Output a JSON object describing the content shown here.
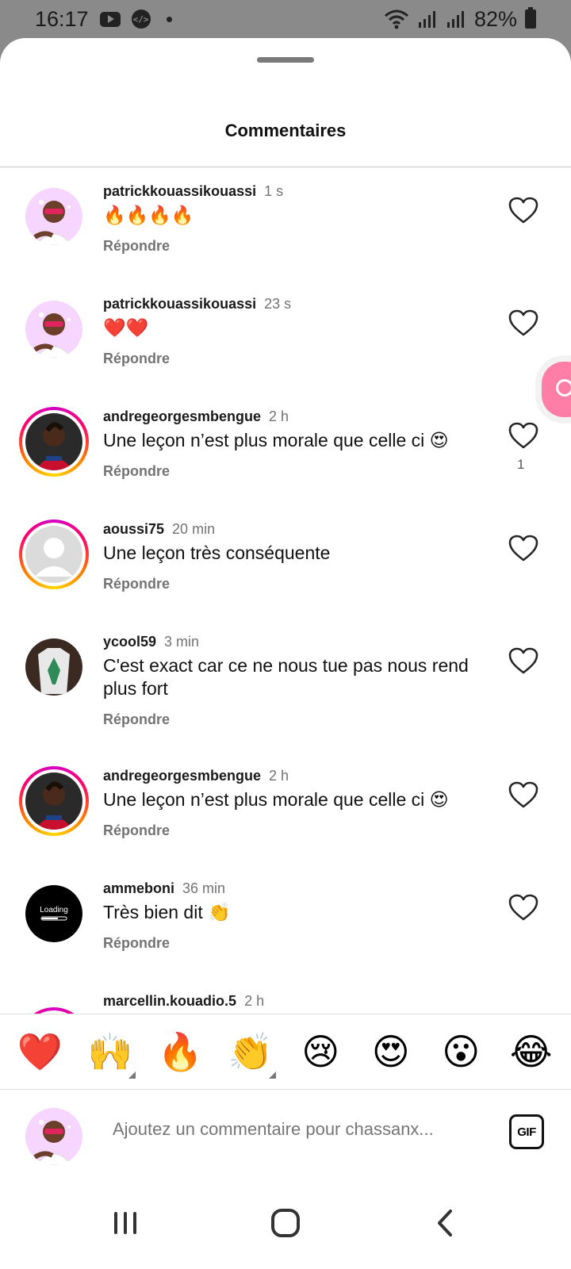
{
  "status_bar": {
    "time": "16:17",
    "battery": "82%",
    "icons": [
      "youtube-icon",
      "code-icon",
      "dot-icon",
      "wifi-icon",
      "signal-icon",
      "signal-icon",
      "battery-icon"
    ]
  },
  "sheet": {
    "title": "Commentaires"
  },
  "comments": [
    {
      "username": "patrickkouassikouassi",
      "time": "1 s",
      "text": "🔥🔥🔥🔥",
      "reply_label": "Répondre",
      "like_count": "",
      "avatar": "cartoon"
    },
    {
      "username": "patrickkouassikouassi",
      "time": "23 s",
      "text": "❤️❤️",
      "reply_label": "Répondre",
      "like_count": "",
      "avatar": "cartoon"
    },
    {
      "username": "andregeorgesmbengue",
      "time": "2 h",
      "text": "Une leçon n’est plus morale que celle ci 😍",
      "reply_label": "Répondre",
      "like_count": "1",
      "avatar": "player"
    },
    {
      "username": "aoussi75",
      "time": "20 min",
      "text": "Une leçon très conséquente",
      "reply_label": "Répondre",
      "like_count": "",
      "avatar": "default"
    },
    {
      "username": "ycool59",
      "time": "3 min",
      "text": "C'est exact car ce ne nous tue pas nous rend plus fort",
      "reply_label": "Répondre",
      "like_count": "",
      "avatar": "shirt"
    },
    {
      "username": "andregeorgesmbengue",
      "time": "2 h",
      "text": "Une leçon n’est plus morale que celle ci 😍",
      "reply_label": "Répondre",
      "like_count": "",
      "avatar": "player"
    },
    {
      "username": "ammeboni",
      "time": "36 min",
      "text": "Très bien dit 👏",
      "reply_label": "Répondre",
      "like_count": "",
      "avatar": "loading",
      "avatar_text": "Loading"
    },
    {
      "username": "marcellin.kouadio.5",
      "time": "2 h",
      "text": "",
      "reply_label": "",
      "like_count": "",
      "avatar": "partial"
    }
  ],
  "emoji_bar": [
    "❤️",
    "🙌",
    "🔥",
    "👏",
    "😢",
    "😍",
    "😮",
    "😂"
  ],
  "composer": {
    "placeholder": "Ajoutez un commentaire pour chassanx...",
    "gif_label": "GIF"
  },
  "colors": {
    "accent_pink": "#ff7ea8",
    "text_secondary": "#737373",
    "story_ring": "#ff0069"
  }
}
